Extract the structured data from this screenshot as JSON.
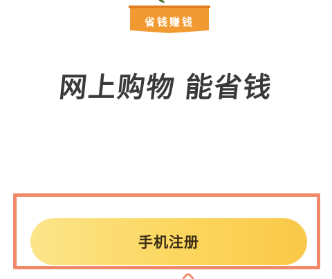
{
  "banner": {
    "text": "省钱赚钱"
  },
  "slogan": {
    "part1": "网上购物",
    "part2": "能省钱"
  },
  "register_button": {
    "label": "手机注册"
  },
  "colors": {
    "banner": "#f29a32",
    "highlight": "#f08a6a",
    "button_start": "#fbe48a",
    "button_end": "#f9c848",
    "slogan_text": "#3a3a3a"
  }
}
